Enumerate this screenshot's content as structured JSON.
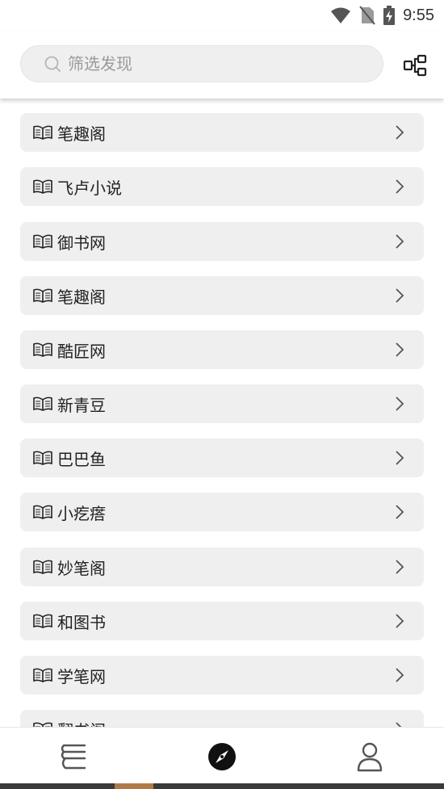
{
  "status": {
    "time": "9:55"
  },
  "search": {
    "placeholder": "筛选发现",
    "value": ""
  },
  "sources": [
    {
      "label": "笔趣阁"
    },
    {
      "label": "飞卢小说"
    },
    {
      "label": "御书网"
    },
    {
      "label": "笔趣阁"
    },
    {
      "label": "酷匠网"
    },
    {
      "label": "新青豆"
    },
    {
      "label": "巴巴鱼"
    },
    {
      "label": "小疙瘩"
    },
    {
      "label": "妙笔阁"
    },
    {
      "label": "和图书"
    },
    {
      "label": "学笔网"
    },
    {
      "label": "翻书阁"
    }
  ],
  "nav": [
    {
      "icon": "bookshelf-icon",
      "active": false
    },
    {
      "icon": "compass-icon",
      "active": true
    },
    {
      "icon": "profile-icon",
      "active": false
    }
  ]
}
